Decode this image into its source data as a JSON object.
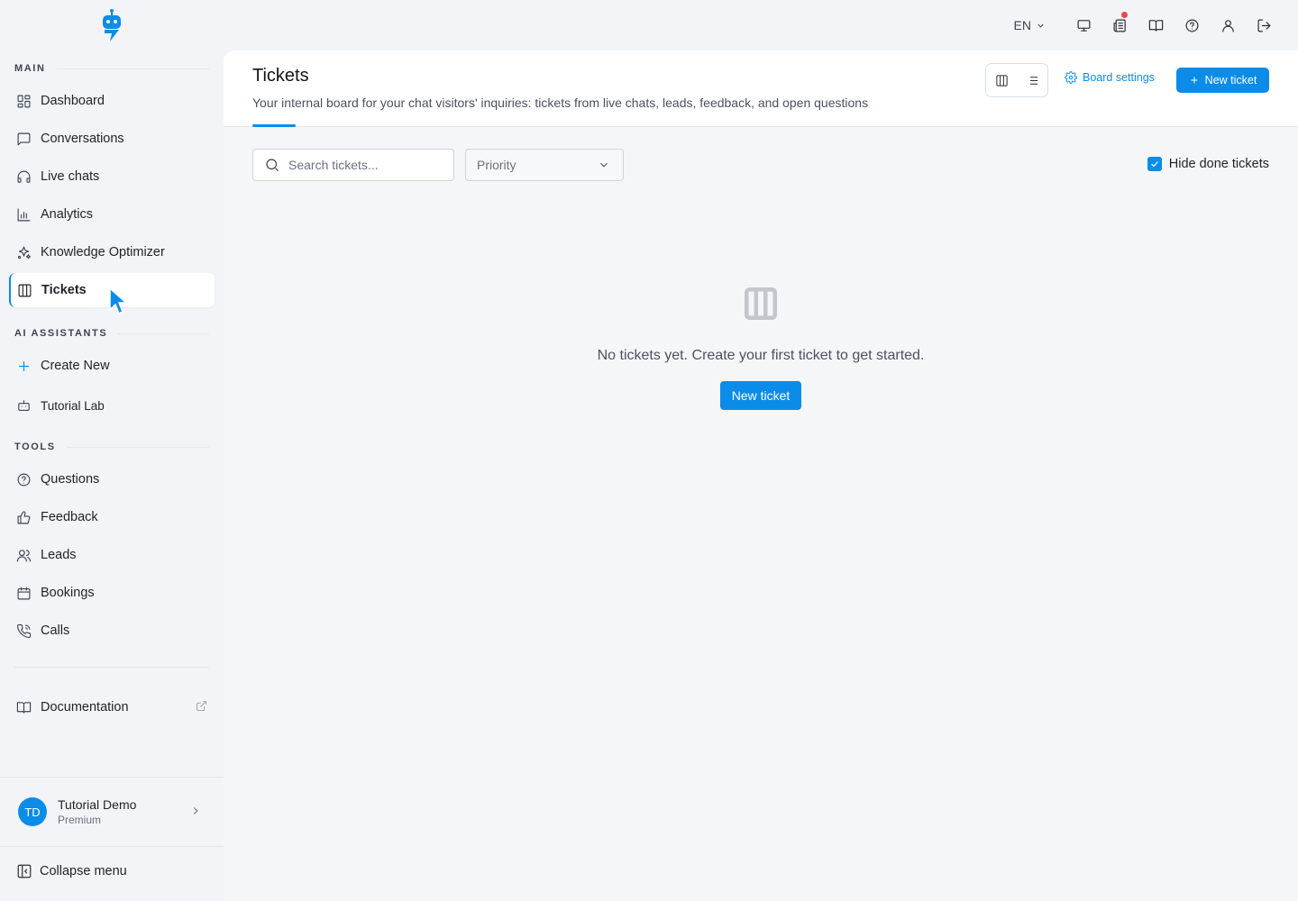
{
  "topbar": {
    "language": "EN",
    "icons": [
      "monitor-icon",
      "news-icon",
      "book-open-icon",
      "help-icon",
      "user-icon",
      "logout-icon"
    ]
  },
  "sidebar": {
    "sections": {
      "main": "MAIN",
      "ai": "AI ASSISTANTS",
      "tools": "TOOLS"
    },
    "main_items": [
      {
        "label": "Dashboard",
        "icon": "dashboard-icon"
      },
      {
        "label": "Conversations",
        "icon": "chat-icon"
      },
      {
        "label": "Live chats",
        "icon": "headset-icon"
      },
      {
        "label": "Analytics",
        "icon": "bar-chart-icon"
      },
      {
        "label": "Knowledge Optimizer",
        "icon": "sparkles-icon"
      },
      {
        "label": "Tickets",
        "icon": "columns-icon",
        "active": true
      }
    ],
    "ai_items": [
      {
        "label": "Create New",
        "icon": "plus-icon"
      },
      {
        "label": "Tutorial Lab",
        "icon": "bot-icon"
      }
    ],
    "tools_items": [
      {
        "label": "Questions",
        "icon": "question-icon"
      },
      {
        "label": "Feedback",
        "icon": "thumbs-up-icon"
      },
      {
        "label": "Leads",
        "icon": "users-icon"
      },
      {
        "label": "Bookings",
        "icon": "calendar-icon"
      },
      {
        "label": "Calls",
        "icon": "phone-icon"
      }
    ],
    "documentation": "Documentation",
    "user": {
      "initials": "TD",
      "name": "Tutorial Demo",
      "plan": "Premium"
    },
    "collapse": "Collapse menu"
  },
  "header": {
    "title": "Tickets",
    "subtitle": "Your internal board for your chat visitors' inquiries: tickets from live chats, leads, feedback, and open questions",
    "board_settings": "Board settings",
    "new_ticket": "New ticket"
  },
  "filters": {
    "search_placeholder": "Search tickets...",
    "priority_placeholder": "Priority",
    "hide_done_label": "Hide done tickets",
    "hide_done_checked": true
  },
  "empty_state": {
    "message": "No tickets yet. Create your first ticket to get started.",
    "button": "New ticket"
  },
  "colors": {
    "accent": "#0b8ce9",
    "background": "#f2f4f7",
    "notification_dot": "#e5484d"
  }
}
